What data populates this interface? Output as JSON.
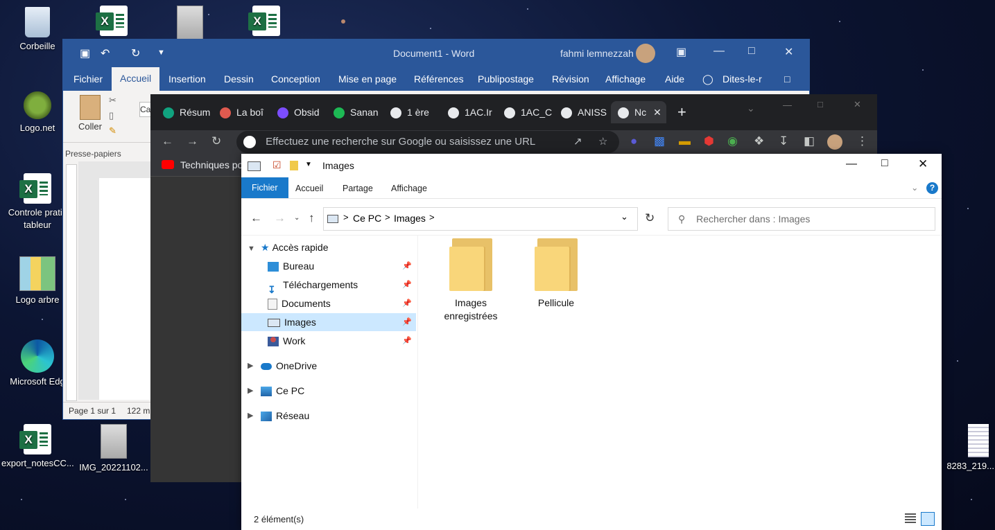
{
  "desktop": {
    "icons": [
      {
        "label": "Corbeille"
      },
      {
        "label": "Logo.net"
      },
      {
        "label": "Controle pratic tableur"
      },
      {
        "label": "Logo arbre"
      },
      {
        "label": "Microsoft Edg"
      },
      {
        "label": "export_notesCC..."
      },
      {
        "label": "IMG_20221102..."
      },
      {
        "label": "8283_219..."
      }
    ]
  },
  "word": {
    "title": "Document1  -  Word",
    "user": "fahmi lemnezzah",
    "tabs": [
      "Fichier",
      "Accueil",
      "Insertion",
      "Dessin",
      "Conception",
      "Mise en page",
      "Références",
      "Publipostage",
      "Révision",
      "Affichage",
      "Aide",
      "Dites-le-r"
    ],
    "paste_label": "Coller",
    "clipboard_group": "Presse-papiers",
    "font_box": "Ca",
    "status_page": "Page 1 sur 1",
    "status_words": "122 m"
  },
  "chrome": {
    "tabs": [
      {
        "label": "Résum",
        "color": "#10a37f"
      },
      {
        "label": "La boî",
        "color": "#e05a4f"
      },
      {
        "label": "Obsid",
        "color": "#7c4dff"
      },
      {
        "label": "Sanan",
        "color": "#1db954"
      },
      {
        "label": "1 ère",
        "color": "#e8eaed"
      },
      {
        "label": "1AC.Ir",
        "color": "#e8eaed"
      },
      {
        "label": "1AC_C",
        "color": "#e8eaed"
      },
      {
        "label": "ANISS",
        "color": "#e8eaed"
      },
      {
        "label": "Nc",
        "color": "#e8eaed"
      }
    ],
    "omnibox_placeholder": "Effectuez une recherche sur Google ou saisissez une URL",
    "bookmark": "Techniques pou"
  },
  "explorer": {
    "title": "Images",
    "ribbon_tabs": [
      "Fichier",
      "Accueil",
      "Partage",
      "Affichage"
    ],
    "breadcrumb": [
      "Ce PC",
      "Images"
    ],
    "search_placeholder": "Rechercher dans : Images",
    "nav": {
      "quick_access": "Accès rapide",
      "pinned": [
        "Bureau",
        "Téléchargements",
        "Documents",
        "Images",
        "Work"
      ],
      "onedrive": "OneDrive",
      "this_pc": "Ce PC",
      "network": "Réseau"
    },
    "folders": [
      {
        "name": "Images enregistrées"
      },
      {
        "name": "Pellicule"
      }
    ],
    "status": "2 élément(s)"
  }
}
